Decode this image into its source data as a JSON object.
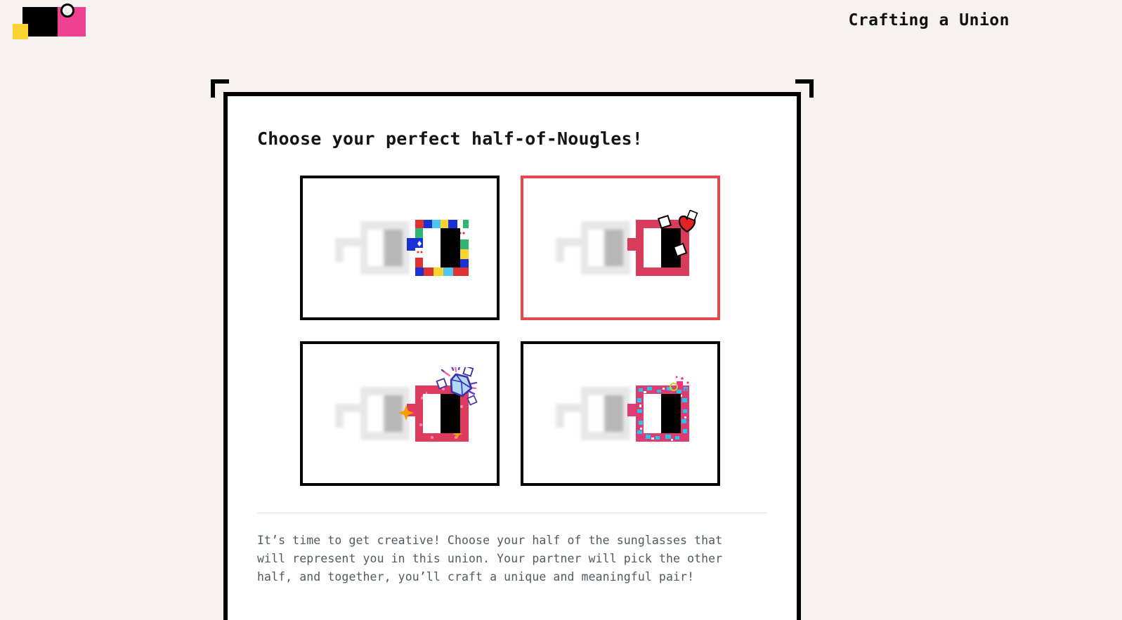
{
  "header": {
    "title": "Crafting a Union",
    "logo": {
      "name": "crafting-a-union-logo",
      "black": "#000000",
      "pink": "#ED4292",
      "yellow": "#FAD32E",
      "circle_outline": "#000000"
    }
  },
  "page": {
    "background_color": "#F7F2F0",
    "card_background": "#FFFFFF",
    "card_border_color": "#000000",
    "title": "Choose your perfect half-of-Nougles!",
    "divider_color": "#E2E2E2",
    "description": "It’s time to get creative! Choose your half of the sunglasses that will represent you in this union. Your partner will pick the other half, and together, you’ll craft a unique and meaningful pair!"
  },
  "selection": {
    "selected_index": 1,
    "selected_border_color": "#E5484D",
    "unselected_border_color": "#000000"
  },
  "options": [
    {
      "name": "option-pixel-blue-arcade",
      "selected": false,
      "frame_style": "pixel-blue-arcade",
      "frame_color": "#1B2FD6",
      "accents": [
        "#E03131",
        "#FAD32E",
        "#2FB673",
        "#4DC7F0",
        "#FFFFFF"
      ],
      "lens_white": "#FFFFFF",
      "lens_black": "#000000"
    },
    {
      "name": "option-pink-heart",
      "selected": true,
      "frame_style": "solid-pink-heart",
      "frame_color": "#D93B5C",
      "accents": [
        "#E02424",
        "#FFFFFF",
        "#000000"
      ],
      "lens_white": "#FFFFFF",
      "lens_black": "#000000"
    },
    {
      "name": "option-pink-gem",
      "selected": false,
      "frame_style": "pink-gem-sparkle",
      "frame_color": "#DE3B5E",
      "accents": [
        "#7B61D9",
        "#F59F00",
        "#FF6FB5",
        "#FFFFFF"
      ],
      "lens_white": "#FFFFFF",
      "lens_black": "#000000"
    },
    {
      "name": "option-pink-cyan-speckle",
      "selected": false,
      "frame_style": "pink-cyan-speckle",
      "frame_color": "#DE3B72",
      "accents": [
        "#22C7F0",
        "#FFFFFF",
        "#FAD32E",
        "#FF2D88"
      ],
      "lens_white": "#FFFFFF",
      "lens_black": "#000000"
    }
  ]
}
